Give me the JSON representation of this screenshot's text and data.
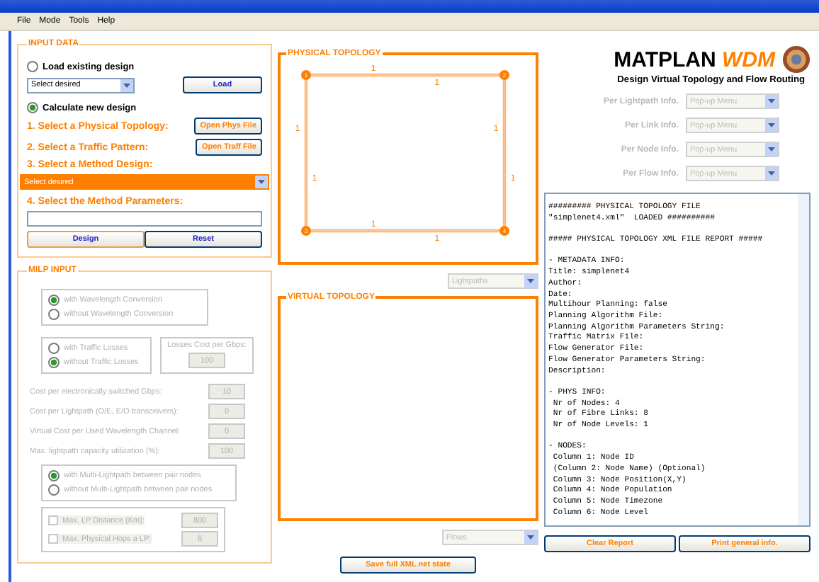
{
  "menu": [
    "File",
    "Mode",
    "Tools",
    "Help"
  ],
  "input_data": {
    "title": "INPUT DATA",
    "load_radio": {
      "label": "Load existing design",
      "selected": false
    },
    "load_select": "Select desired",
    "load_button": "Load",
    "calc_radio": {
      "label": "Calculate new design",
      "selected": true
    },
    "step1": "1. Select a Physical Topology:",
    "phys_button": "Open Phys File",
    "step2": "2. Select a Traffic Pattern:",
    "traff_button": "Open Traff File",
    "step3": "3. Select a Method Design:",
    "method_select": "Select desired",
    "step4": "4. Select the Method Parameters:",
    "buttons": [
      "Design",
      "Reset"
    ]
  },
  "milp": {
    "title": "MILP INPUT",
    "disabled": true,
    "conversion": [
      {
        "label": "with Wavelength Conversion",
        "selected": true
      },
      {
        "label": "without Wavelength Conversion",
        "selected": false
      }
    ],
    "losses": [
      {
        "label": "with Traffic Losses",
        "selected": false
      },
      {
        "label": "without Traffic Losses",
        "selected": true
      }
    ],
    "losses_cost": {
      "label": "Losses Cost per Gbps:",
      "value": "100"
    },
    "params": [
      {
        "label": "Cost per electronically switched Gbps:",
        "value": "10"
      },
      {
        "label": "Cost per Lightpath (O/E, E/O transceivers):",
        "value": "0"
      },
      {
        "label": "Virtual Cost per Used Wavelength Channel:",
        "value": "0"
      },
      {
        "label": "Max. lightpath capacity utilization (%):",
        "value": "100"
      }
    ],
    "multi": [
      {
        "label": "with Multi-Lightpath between pair nodes",
        "selected": true
      },
      {
        "label": "without Multi-Lightpath between pair nodes",
        "selected": false
      }
    ],
    "limits": [
      {
        "label": "Max. LP Distance (Km):",
        "checked": false,
        "value": "800"
      },
      {
        "label": "Max. Physical Hops a LP:",
        "checked": false,
        "value": "6"
      }
    ]
  },
  "physical_topology": {
    "title": "PHYSICAL TOPOLOGY",
    "nodes": [
      {
        "label": "1"
      },
      {
        "label": "2"
      },
      {
        "label": "3"
      },
      {
        "label": "4"
      }
    ],
    "links": [
      {
        "label": "1"
      },
      {
        "label": "1"
      },
      {
        "label": "1"
      },
      {
        "label": "1"
      },
      {
        "label": "1"
      },
      {
        "label": "1"
      },
      {
        "label": "1"
      },
      {
        "label": "1"
      }
    ]
  },
  "lightpaths_select": "Lightpaths",
  "virtual_topology": {
    "title": "VIRTUAL TOPOLOGY"
  },
  "flows_select": "Flows",
  "save_button": "Save full XML net state",
  "logo": {
    "title": "MATPLAN",
    "accent": "WDM",
    "subtitle": "Design Virtual Topology and Flow Routing"
  },
  "info_selects": [
    {
      "label": "Per Lightpath Info.",
      "value": "Pop-up Menu"
    },
    {
      "label": "Per Link Info.",
      "value": "Pop-up Menu"
    },
    {
      "label": "Per Node Info.",
      "value": "Pop-up Menu"
    },
    {
      "label": "Per Flow Info.",
      "value": "Pop-up Menu"
    }
  ],
  "report": [
    [
      "######### PHYSICAL TOPOLOGY FILE",
      "\"simplenet4.xml\"  LOADED ##########"
    ],
    [
      "##### PHYSICAL TOPOLOGY XML FILE REPORT #####"
    ],
    [
      "- METADATA INFO:",
      "Title: simplenet4",
      "Author:",
      "Date:",
      "Multihour Planning: false",
      "Planning Algorithm File:",
      "Planning Algorithm Parameters String:",
      "Traffic Matrix File:",
      "Flow Generator File:",
      "Flow Generator Parameters String:",
      "Description:"
    ],
    [
      "- PHYS INFO:",
      " Nr of Nodes: 4",
      " Nr of Fibre Links: 8",
      " Nr of Node Levels: 1"
    ],
    [
      "- NODES:",
      " Column 1: Node ID",
      " (Column 2: Node Name) (Optional)",
      " Column 3: Node Position(X,Y)",
      " Column 4: Node Population",
      " Column 5: Node Timezone",
      " Column 6: Node Level"
    ]
  ],
  "report_buttons": [
    "Clear Report",
    "Print general info."
  ]
}
